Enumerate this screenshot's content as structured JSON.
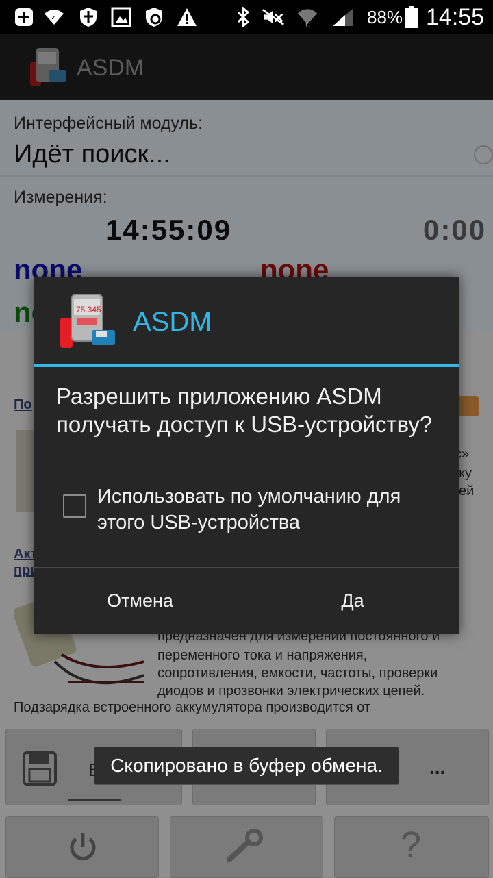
{
  "status_bar": {
    "battery_percent": "88%",
    "time": "14:55",
    "icons": [
      "plus-icon",
      "wifi-icon",
      "shield-icon",
      "image-icon",
      "shield-refresh-icon",
      "warning-icon",
      "bluetooth-icon",
      "mute-icon",
      "wifi-signal-icon",
      "cell-signal-icon",
      "battery-icon"
    ]
  },
  "action_bar": {
    "title": "ASDM"
  },
  "background": {
    "module_label": "Интерфейсный модуль:",
    "module_value": "Идёт поиск...",
    "measure_label": "Измерения:",
    "clock": "14:55:09",
    "clock2": "0:00",
    "none_blue": "none",
    "none_red": "none",
    "green_partial": "no",
    "link1": "По",
    "link2_line1": "Акт",
    "link2_line2": "при",
    "right_frag1": "с»",
    "right_frag2": "ку",
    "right_frag3": "ей",
    "desc_line1": "предназначен для измерений постоянного и",
    "desc_line2": "переменного тока и напряжения,",
    "desc_line3": "сопротивления, емкости, частоты, проверки",
    "desc_line4": "диодов и прозвонки электрических цепей.",
    "desc_line5": "Подзарядка встроенного аккумулятора производится от",
    "btn_save_frag": "В",
    "btn_more": "..."
  },
  "dialog": {
    "title": "ASDM",
    "message": "Разрешить приложению ASDM получать доступ к USB-устройству?",
    "checkbox_label": "Использовать по умолчанию для этого USB-устройства",
    "checkbox_checked": false,
    "cancel_label": "Отмена",
    "ok_label": "Да",
    "accent_color": "#33b5e5"
  },
  "toast": {
    "text": "Скопировано в буфер обмена."
  }
}
